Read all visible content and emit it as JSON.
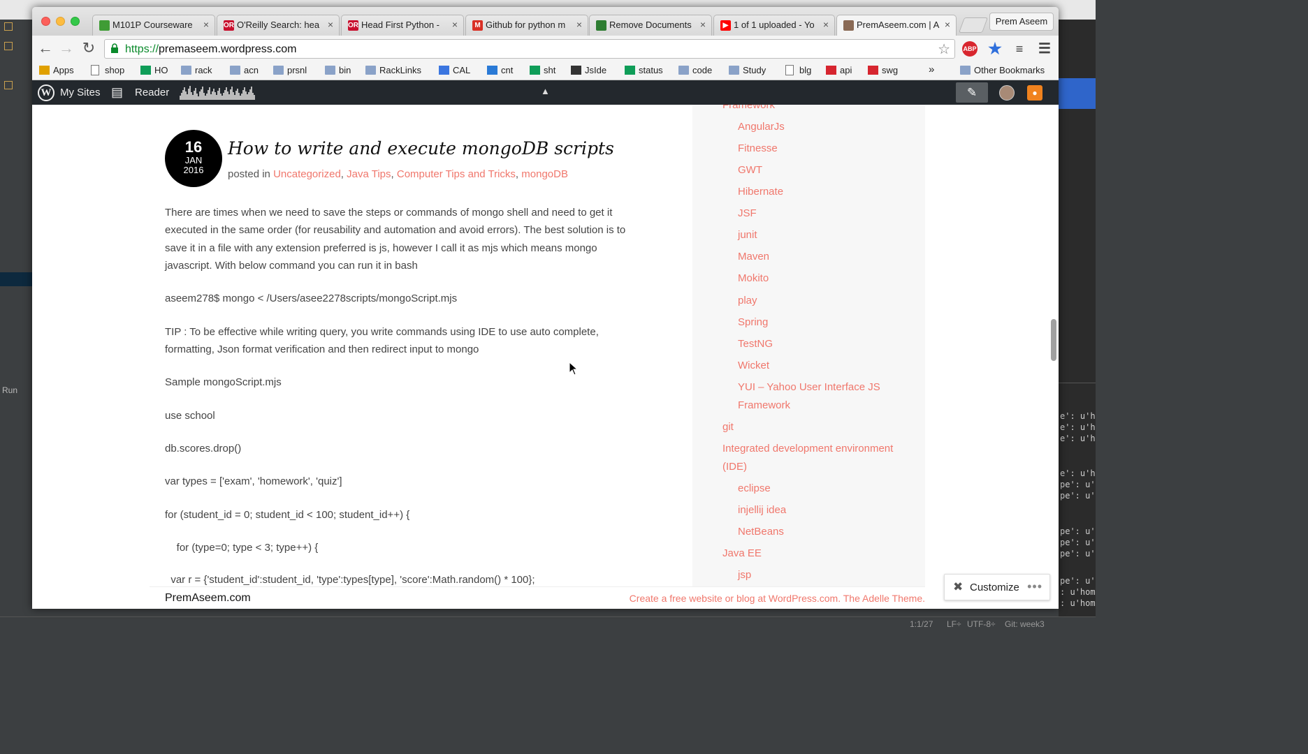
{
  "browser": {
    "tabs": [
      {
        "label": "M101P Courseware",
        "favicon_color": "#3f9c35",
        "favicon_text": ""
      },
      {
        "label": "O'Reilly Search: hea",
        "favicon_color": "#c8102e",
        "favicon_text": "OR"
      },
      {
        "label": "Head First Python -",
        "favicon_color": "#c8102e",
        "favicon_text": "OR"
      },
      {
        "label": "Github for python m",
        "favicon_color": "#d93025",
        "favicon_text": "M"
      },
      {
        "label": "Remove Documents",
        "favicon_color": "#2e7d32",
        "favicon_text": ""
      },
      {
        "label": "1 of 1 uploaded - Yo",
        "favicon_color": "#ff0000",
        "favicon_text": "▶"
      },
      {
        "label": "PremAseem.com | A",
        "favicon_color": "#8a6a55",
        "favicon_text": ""
      }
    ],
    "profile_name": "Prem Aseem",
    "url_scheme": "https://",
    "url_host": "premaseem.wordpress.com",
    "bookmarks": [
      {
        "label": "Apps",
        "icon": "apps-grid-icon"
      },
      {
        "label": "shop",
        "icon": "page-icon"
      },
      {
        "label": "HO",
        "icon": "hangouts-icon"
      },
      {
        "label": "rack",
        "icon": "folder-icon"
      },
      {
        "label": "acn",
        "icon": "folder-icon"
      },
      {
        "label": "prsnl",
        "icon": "folder-icon"
      },
      {
        "label": "bin",
        "icon": "folder-icon"
      },
      {
        "label": "RackLinks",
        "icon": "folder-icon"
      },
      {
        "label": "CAL",
        "icon": "calendar-icon"
      },
      {
        "label": "cnt",
        "icon": "contacts-icon"
      },
      {
        "label": "sht",
        "icon": "sheets-icon"
      },
      {
        "label": "JsIde",
        "icon": "download-icon"
      },
      {
        "label": "status",
        "icon": "sheets-icon"
      },
      {
        "label": "code",
        "icon": "folder-icon"
      },
      {
        "label": "Study",
        "icon": "folder-icon"
      },
      {
        "label": "blg",
        "icon": "page-icon"
      },
      {
        "label": "api",
        "icon": "angular-icon"
      },
      {
        "label": "swg",
        "icon": "spinner-icon"
      }
    ],
    "bookmarks_overflow": "»",
    "other_bookmarks": "Other Bookmarks"
  },
  "wpbar": {
    "my_sites": "My Sites",
    "reader": "Reader"
  },
  "post": {
    "day": "16",
    "month": "JAN",
    "year": "2016",
    "title": "How to write and execute mongoDB scripts",
    "meta_prefix": "posted in",
    "categories": [
      "Uncategorized",
      "Java Tips",
      "Computer Tips and Tricks",
      "mongoDB"
    ],
    "lines": [
      "There are times when we need to save the steps or commands of mongo shell and need to get it",
      "executed in the same order (for reusability and automation and avoid errors). The best solution is to",
      "save it in a file with any extension preferred is js, however I call it as mjs which means mongo",
      "javascript. With below command you can run it in bash",
      "aseem278$ mongo < /Users/asee2278scripts/mongoScript.mjs",
      "TIP : To be effective while writing query, you write commands using IDE to use auto complete,",
      "formatting, Json format verification and then redirect input to mongo",
      "Sample mongoScript.mjs",
      "use school",
      "db.scores.drop()",
      "var types = ['exam', 'homework', 'quiz']",
      "for (student_id = 0; student_id < 100; student_id++) {",
      "    for (type=0; type < 3; type++) {",
      "  var r = {'student_id':student_id, 'type':types[type], 'score':Math.random() * 100};"
    ]
  },
  "sidebar": {
    "items": [
      {
        "label": "Framework",
        "level": 0
      },
      {
        "label": "AngularJs",
        "level": 1
      },
      {
        "label": "Fitnesse",
        "level": 1
      },
      {
        "label": "GWT",
        "level": 1
      },
      {
        "label": "Hibernate",
        "level": 1
      },
      {
        "label": "JSF",
        "level": 1
      },
      {
        "label": "junit",
        "level": 1
      },
      {
        "label": "Maven",
        "level": 1
      },
      {
        "label": "Mokito",
        "level": 1
      },
      {
        "label": "play",
        "level": 1
      },
      {
        "label": "Spring",
        "level": 1
      },
      {
        "label": "TestNG",
        "level": 1
      },
      {
        "label": "Wicket",
        "level": 1
      },
      {
        "label": "YUI – Yahoo User Interface JS",
        "level": 1
      },
      {
        "label": "Framework",
        "level": 1
      },
      {
        "label": "git",
        "level": 0
      },
      {
        "label": "Integrated development environment",
        "level": 0
      },
      {
        "label": "(IDE)",
        "level": 0
      },
      {
        "label": "eclipse",
        "level": 1
      },
      {
        "label": "injellij idea",
        "level": 1
      },
      {
        "label": "NetBeans",
        "level": 1
      },
      {
        "label": "Java EE",
        "level": 0
      },
      {
        "label": "jsp",
        "level": 1
      }
    ]
  },
  "footer": {
    "site_name": "PremAseem.com",
    "credit": "Create a free website or blog at WordPress.com. The Adelle Theme."
  },
  "customize": {
    "label": "Customize"
  },
  "ide": {
    "run_label": "Run",
    "console_lines": [
      "e': u'h",
      "e': u'h",
      "e': u'h",
      "e': u'h",
      "pe': u'",
      "pe': u'",
      "pe': u'",
      "pe': u'",
      "pe': u'",
      "pe': u'",
      ": u'hom",
      ": u'hom"
    ],
    "status_position": "1:1/27",
    "status_lf": "LF÷",
    "status_encoding": "UTF-8÷",
    "status_git": "Git: week3"
  },
  "colors": {
    "accent": "#f0776c",
    "wpbar": "#23282d",
    "url_green": "#0a8a2b"
  }
}
